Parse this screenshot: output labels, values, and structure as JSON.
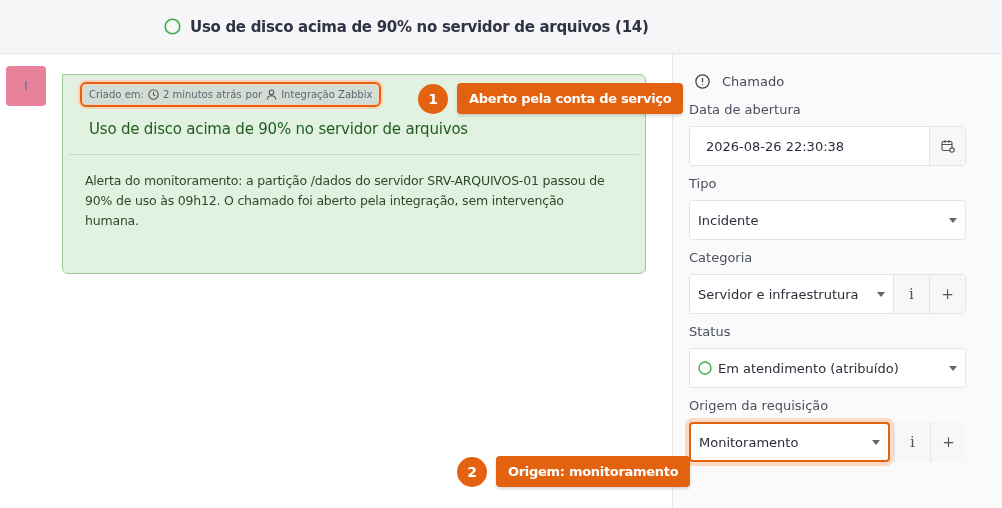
{
  "header": {
    "title": "Uso de disco acima de 90% no servidor de arquivos (14)"
  },
  "avatar": {
    "initial": "I"
  },
  "message": {
    "meta": {
      "created_label": "Criado em:",
      "time": "2 minutos atrás",
      "by": "por",
      "author": "Integração Zabbix",
      "highlighted": true
    },
    "title": "Uso de disco acima de 90% no servidor de arquivos",
    "body": "Alerta do monitoramento: a partição /dados do servidor SRV-ARQUIVOS-01 passou de 90% de uso às 09h12. O chamado foi aberto pela integração, sem intervenção humana."
  },
  "panel": {
    "title": "Chamado",
    "fields": [
      {
        "kind": "date",
        "label": "Data de abertura",
        "value": "2026-08-26 22:30:38",
        "highlighted": false
      },
      {
        "kind": "select",
        "label": "Tipo",
        "value": "Incidente",
        "highlighted": false
      },
      {
        "kind": "select_actions",
        "label": "Categoria",
        "value": "Servidor e infraestrutura",
        "info": "i",
        "add": "+",
        "highlighted": false
      },
      {
        "kind": "status",
        "label": "Status",
        "value": "Em atendimento (atribuído)",
        "highlighted": false
      },
      {
        "kind": "select_actions",
        "label": "Origem da requisição",
        "value": "Monitoramento",
        "info": "i",
        "add": "+",
        "highlighted": true
      }
    ]
  },
  "annotations": [
    {
      "number": "1",
      "text": "Aberto pela conta de serviço"
    },
    {
      "number": "2",
      "text": "Origem: monitoramento"
    }
  ]
}
